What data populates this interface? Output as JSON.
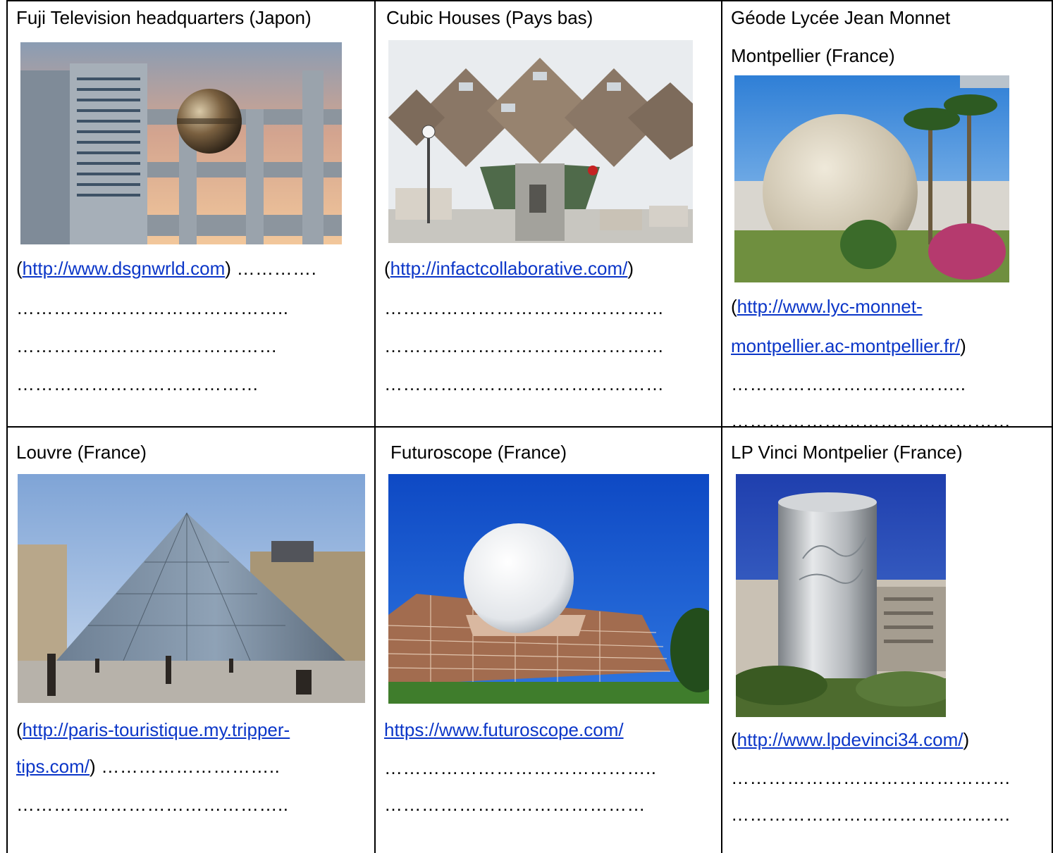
{
  "cells": [
    {
      "title": "Fuji Television headquarters (Japon)",
      "link": "http://www.dsgnwrld.com",
      "after_link": " ………….",
      "dots": [
        "……………………………………..",
        "……………………………………",
        "…………………………………"
      ]
    },
    {
      "title": "Cubic Houses (Pays bas)",
      "link": "http://infactcollaborative.com/",
      "after_link": "",
      "dots": [
        "………………………………………",
        "………………………………………",
        "………………………………………"
      ]
    },
    {
      "title_line1": "Géode Lycée Jean Monnet",
      "title_line2": "Montpellier (France)",
      "link_line1": "http://www.lyc-monnet-",
      "link_line2": "montpellier.ac-montpellier.fr/",
      "dots": [
        "………………………………..",
        "………………………………………"
      ]
    },
    {
      "title": "Louvre (France)",
      "link_line1": "http://paris-touristique.my.tripper-",
      "link_line2": "tips.com/",
      "after_link": " ………………………..",
      "dots": [
        "…………………………………….."
      ]
    },
    {
      "title": "Futuroscope (France)",
      "link": "https://www.futuroscope.com/",
      "dots": [
        "……………………………………..",
        "……………………………………"
      ]
    },
    {
      "title": "LP Vinci Montpelier (France)",
      "link": "http://www.lpdevinci34.com/",
      "dots": [
        "………………………………………",
        "………………………………………"
      ]
    }
  ],
  "paren_open": "(",
  "paren_close": ")"
}
